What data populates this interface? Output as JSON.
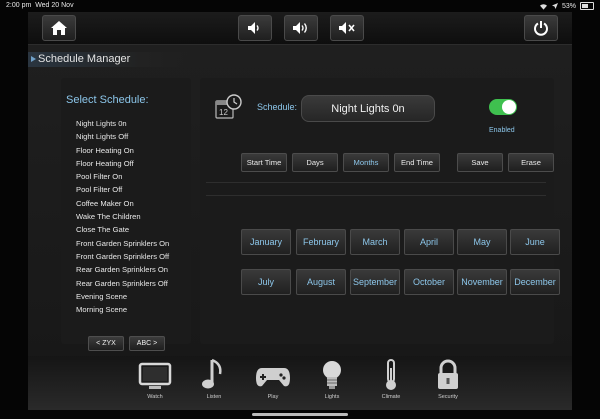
{
  "status_bar": {
    "time": "2:00 pm",
    "date": "Wed 20 Nov",
    "battery": "53%"
  },
  "topbar": {
    "icons": [
      "home-icon",
      "volume-down-icon",
      "volume-up-icon",
      "mute-icon",
      "power-icon"
    ]
  },
  "title": "Schedule Manager",
  "select_schedule": {
    "header": "Select Schedule:",
    "items": [
      "Night Lights 0n",
      "Night Lights Off",
      "Floor Heating On",
      "Floor Heating Off",
      "Pool Filter On",
      "Pool Filter Off",
      "Coffee Maker On",
      "Wake The Children",
      "Close The Gate",
      "Front Garden Sprinklers On",
      "Front Garden Sprinklers Off",
      "Rear Garden Sprinklers On",
      "Rear Garden Sprinklers Off",
      "Evening Scene",
      "Morning Scene"
    ],
    "prev_label": "< ZYX",
    "next_label": "ABC >"
  },
  "schedule": {
    "label": "Schedule:",
    "name": "Night Lights 0n",
    "enabled": true,
    "enabled_label": "Enabled"
  },
  "tabs": {
    "start_time": "Start Time",
    "days": "Days",
    "months": "Months",
    "end_time": "End Time",
    "save": "Save",
    "erase": "Erase"
  },
  "months": [
    "January",
    "February",
    "March",
    "April",
    "May",
    "June",
    "July",
    "August",
    "September",
    "October",
    "November",
    "December"
  ],
  "dock": [
    {
      "label": "Watch"
    },
    {
      "label": "Listen"
    },
    {
      "label": "Play"
    },
    {
      "label": "Lights"
    },
    {
      "label": "Climate"
    },
    {
      "label": "Security"
    }
  ],
  "colors": {
    "accent": "#8cc6ea",
    "toggle_on": "#3fc04f",
    "background": "#1b1b1b"
  }
}
